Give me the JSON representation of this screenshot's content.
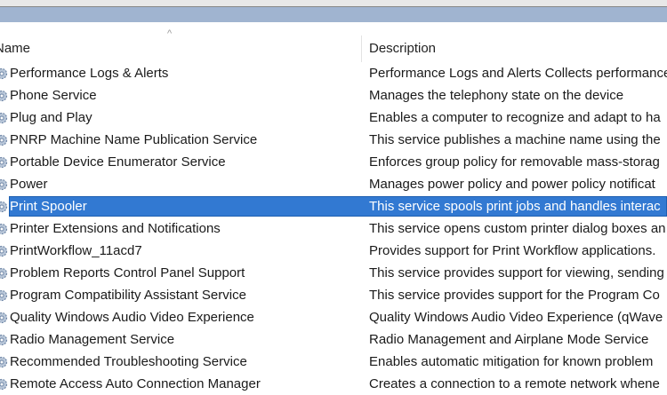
{
  "columns": {
    "name": "Name",
    "description": "Description",
    "sort_indicator": "^"
  },
  "selected_index": 6,
  "rows": [
    {
      "name": "Performance Logs & Alerts",
      "description": "Performance Logs and Alerts Collects performance"
    },
    {
      "name": "Phone Service",
      "description": "Manages the telephony state on the device"
    },
    {
      "name": "Plug and Play",
      "description": "Enables a computer to recognize and adapt to ha"
    },
    {
      "name": "PNRP Machine Name Publication Service",
      "description": "This service publishes a machine name using the"
    },
    {
      "name": "Portable Device Enumerator Service",
      "description": "Enforces group policy for removable mass-storag"
    },
    {
      "name": "Power",
      "description": "Manages power policy and power policy notificat"
    },
    {
      "name": "Print Spooler",
      "description": "This service spools print jobs and handles interac"
    },
    {
      "name": "Printer Extensions and Notifications",
      "description": "This service opens custom printer dialog boxes an"
    },
    {
      "name": "PrintWorkflow_11acd7",
      "description": "Provides support for Print Workflow applications."
    },
    {
      "name": "Problem Reports Control Panel Support",
      "description": "This service provides support for viewing, sending"
    },
    {
      "name": "Program Compatibility Assistant Service",
      "description": "This service provides support for the Program Co"
    },
    {
      "name": "Quality Windows Audio Video Experience",
      "description": "Quality Windows Audio Video Experience (qWave"
    },
    {
      "name": "Radio Management Service",
      "description": "Radio Management and Airplane Mode Service"
    },
    {
      "name": "Recommended Troubleshooting Service",
      "description": "Enables automatic mitigation for known problem"
    },
    {
      "name": "Remote Access Auto Connection Manager",
      "description": "Creates a connection to a remote network whene"
    }
  ]
}
